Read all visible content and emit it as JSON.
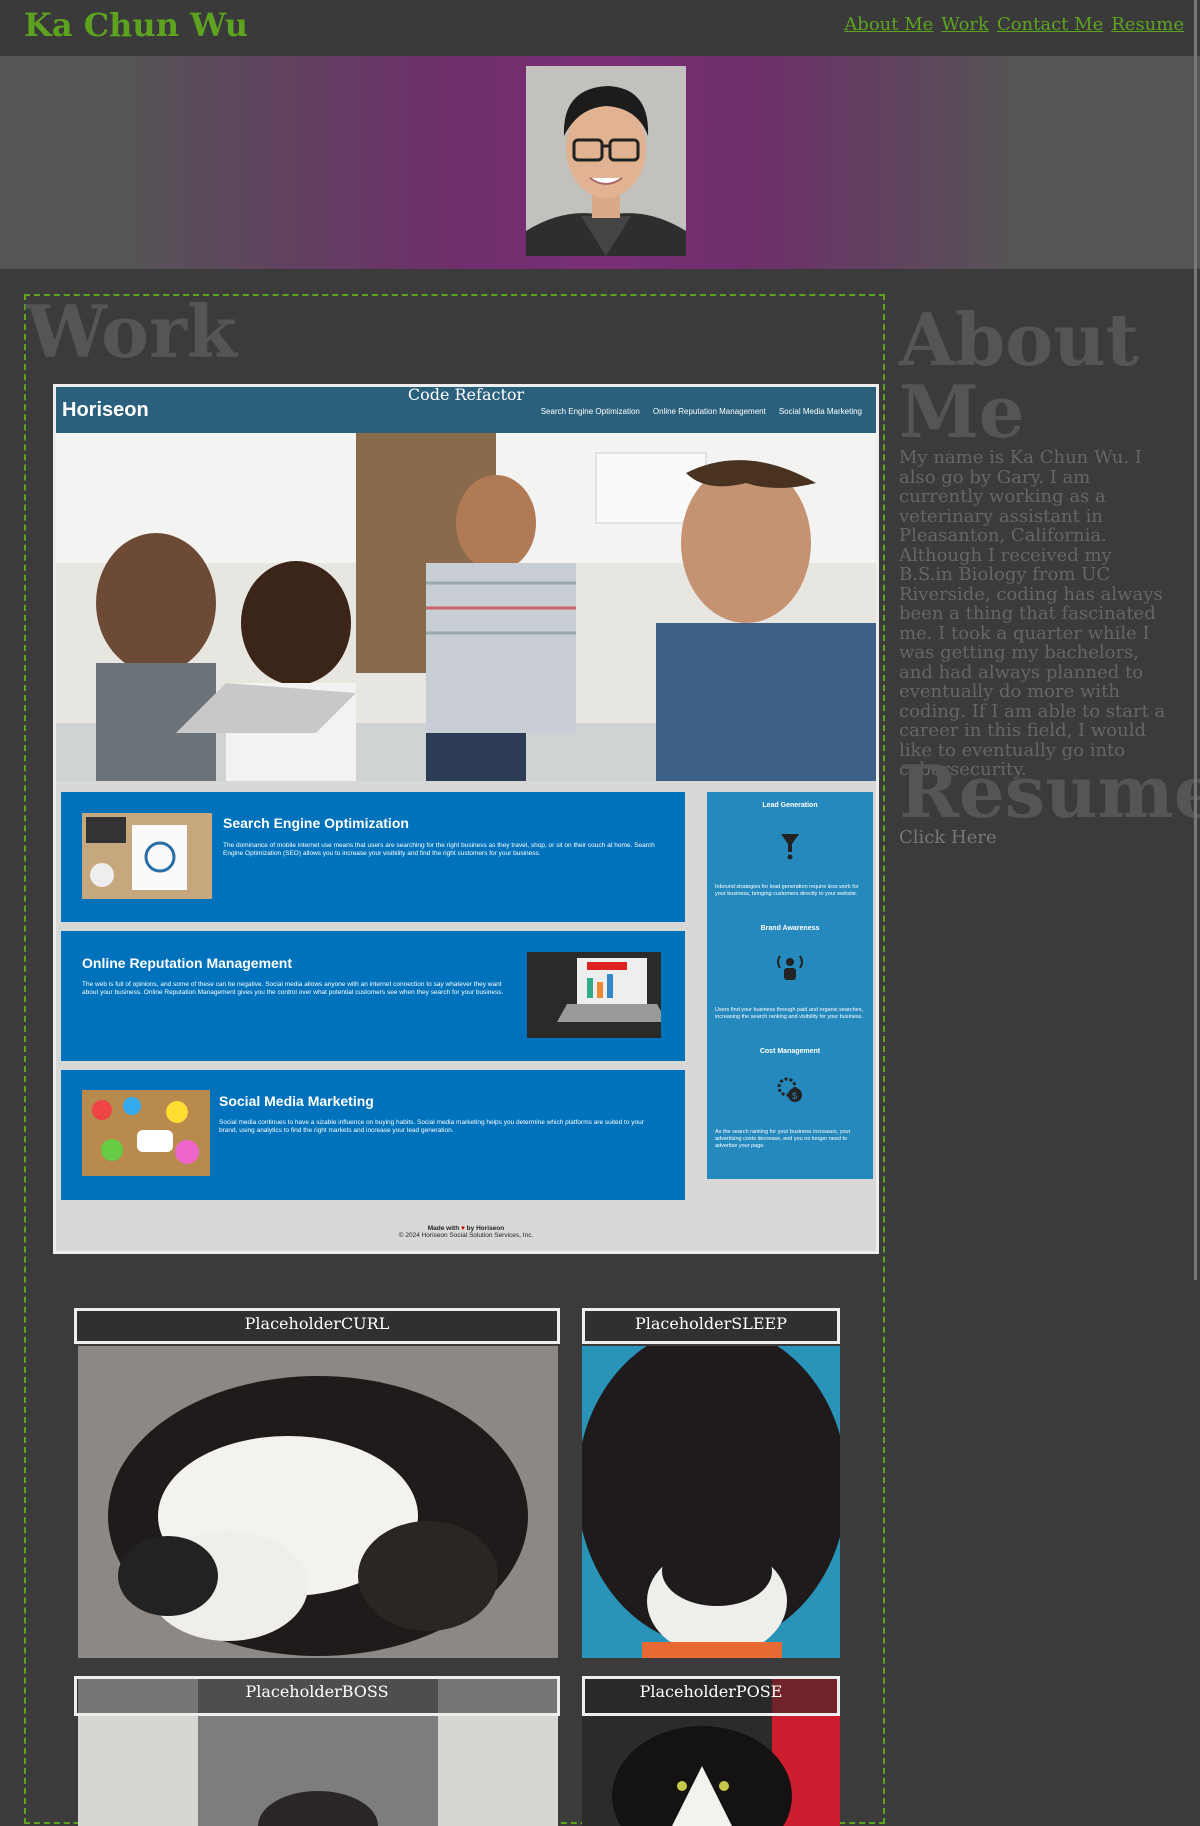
{
  "header": {
    "site_title": "Ka Chun Wu",
    "nav": [
      "About Me",
      "Work",
      "Contact Me",
      "Resume"
    ]
  },
  "colors": {
    "accent_green": "#5ea31f",
    "background": "#3b3b3b",
    "hero_purple": "#7a2f76"
  },
  "work": {
    "heading": "Work",
    "main_project": {
      "label": "Code Refactor",
      "horiseon": {
        "logo": "Horiseon",
        "nav": [
          "Search Engine Optimization",
          "Online Reputation Management",
          "Social Media Marketing"
        ],
        "boxes": [
          {
            "title": "Search Engine Optimization",
            "text": "The dominance of mobile internet use means that users are searching for the right business as they travel, shop, or sit on their couch at home. Search Engine Optimization (SEO) allows you to increase your visibility and find the right customers for your business."
          },
          {
            "title": "Online Reputation Management",
            "text": "The web is full of opinions, and some of these can be negative. Social media allows anyone with an internet connection to say whatever they want about your business. Online Reputation Management gives you the control over what potential customers see when they search for your business."
          },
          {
            "title": "Social Media Marketing",
            "text": "Social media continues to have a sizable influence on buying habits. Social media marketing helps you determine which platforms are suited to your brand, using analytics to find the right markets and increase your lead generation."
          }
        ],
        "aside": [
          {
            "title": "Lead Generation",
            "text": "Inbound strategies for lead generation require less work for your business, bringing customers directly to your website."
          },
          {
            "title": "Brand Awareness",
            "text": "Users find your business through paid and organic searches, increasing the search ranking and visibility for your business."
          },
          {
            "title": "Cost Management",
            "text": "As the search ranking for your business increases, your advertising costs decrease, and you no longer need to advertise your page."
          }
        ],
        "footer_made": "Made with",
        "footer_by": "by Horiseon",
        "footer_copy": "© 2024 Horiseon Social Solution Services, Inc."
      }
    },
    "placeholders": [
      "PlaceholderCURL",
      "PlaceholderSLEEP",
      "PlaceholderBOSS",
      "PlaceholderPOSE"
    ]
  },
  "about": {
    "heading": "About Me",
    "text": "My name is Ka Chun Wu. I also go by Gary. I am currently working as a veterinary assistant in Pleasanton, California. Although I received my B.S.in Biology from UC Riverside, coding has always been a thing that fascinated me. I took a quarter while I was getting my bachelors, and had always planned to eventually do more with coding. If I am able to start a career in this field, I would like to eventually go into cybersecurity."
  },
  "resume": {
    "heading": "Resume",
    "link": "Click Here"
  }
}
